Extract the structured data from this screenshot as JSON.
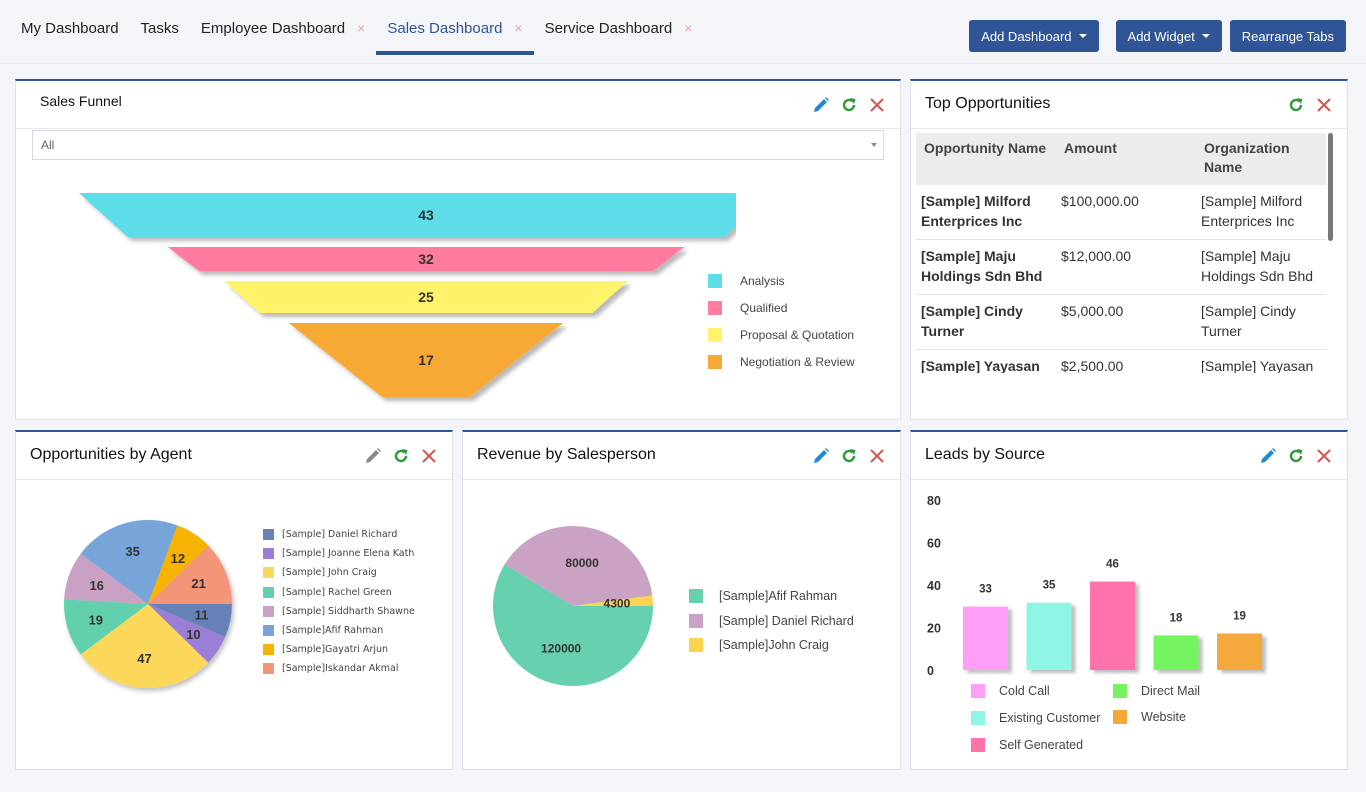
{
  "tabs": [
    {
      "label": "My Dashboard",
      "closable": false,
      "active": false
    },
    {
      "label": "Tasks",
      "closable": false,
      "active": false
    },
    {
      "label": "Employee Dashboard",
      "closable": true,
      "active": false
    },
    {
      "label": "Sales Dashboard",
      "closable": true,
      "active": true
    },
    {
      "label": "Service Dashboard",
      "closable": true,
      "active": false
    }
  ],
  "close_glyph": "×",
  "toolbar": {
    "add_dashboard": "Add Dashboard",
    "add_widget": "Add Widget",
    "rearrange_tabs": "Rearrange Tabs"
  },
  "colors": {
    "accent": "#2f5597",
    "edit_icon": "#1f8bd0",
    "edit_icon_muted": "#8a8a8a",
    "refresh_icon": "#2e9a3a",
    "close_icon": "#d9534f"
  },
  "widgets": {
    "sales_funnel": {
      "title": "Sales Funnel",
      "filter": {
        "value": "All"
      },
      "chart_data": {
        "type": "funnel",
        "title": "Sales Funnel",
        "categories": [
          "Analysis",
          "Qualified",
          "Proposal & Quotation",
          "Negotiation & Review"
        ],
        "values": [
          43,
          32,
          25,
          17
        ],
        "colors": [
          "#5cdde8",
          "#ff7ba0",
          "#fef36a",
          "#f6a935"
        ],
        "legend_position": "right"
      }
    },
    "top_opportunities": {
      "title": "Top Opportunities",
      "columns": [
        "Opportunity Name",
        "Amount",
        "Organization Name"
      ],
      "rows": [
        {
          "name": "[Sample] Milford Enterprices Inc",
          "amount": "$100,000.00",
          "org": "[Sample] Milford Enterprices Inc"
        },
        {
          "name": "[Sample] Maju Holdings Sdn Bhd",
          "amount": "$12,000.00",
          "org": "[Sample] Maju Holdings Sdn Bhd"
        },
        {
          "name": "[Sample] Cindy Turner",
          "amount": "$5,000.00",
          "org": "[Sample] Cindy Turner"
        },
        {
          "name": "[Sample] Yayasan Holdings Sdn Bhd",
          "amount": "$2,500.00",
          "org": "[Sample] Yayasan Holdings Sdn Bhd"
        }
      ]
    },
    "opportunities_by_agent": {
      "title": "Opportunities by Agent",
      "chart_data": {
        "type": "pie",
        "title": "Opportunities by Agent",
        "categories": [
          "[Sample] Daniel Richard",
          "[Sample] Joanne Elena Kath",
          "[Sample] John Craig",
          "[Sample] Rachel Green",
          "[Sample] Siddharth Shawne",
          "[Sample]Afif Rahman",
          "[Sample]Gayatri Arjun",
          "[Sample]Iskandar Akmal"
        ],
        "values": [
          11,
          10,
          47,
          19,
          16,
          35,
          12,
          21
        ],
        "colors": [
          "#6681b8",
          "#9b7ed6",
          "#fcd85a",
          "#62d0ad",
          "#c9a1c4",
          "#77a5d9",
          "#f6b400",
          "#f39579"
        ],
        "legend_position": "right"
      }
    },
    "revenue_by_salesperson": {
      "title": "Revenue by Salesperson",
      "chart_data": {
        "type": "pie",
        "title": "Revenue by Salesperson",
        "categories": [
          "[Sample]Afif Rahman",
          "[Sample] Daniel Richard",
          "[Sample]John Craig"
        ],
        "values": [
          120000,
          80000,
          4300
        ],
        "colors": [
          "#66d0b0",
          "#c9a2c4",
          "#fcd34f"
        ],
        "legend_position": "right"
      }
    },
    "leads_by_source": {
      "title": "Leads by Source",
      "chart_data": {
        "type": "bar",
        "title": "Leads by Source",
        "categories": [
          "Cold Call",
          "Existing Customer",
          "Self Generated",
          "Direct Mail",
          "Website"
        ],
        "values": [
          33,
          35,
          46,
          18,
          19
        ],
        "colors": [
          "#ff9ef7",
          "#8ff5e6",
          "#ff72aa",
          "#76f45f",
          "#f5a83a"
        ],
        "yticks": [
          0,
          20,
          40,
          60,
          80
        ],
        "ylim": [
          0,
          80
        ],
        "xlabel": "",
        "ylabel": "",
        "legend_position": "bottom"
      }
    }
  }
}
